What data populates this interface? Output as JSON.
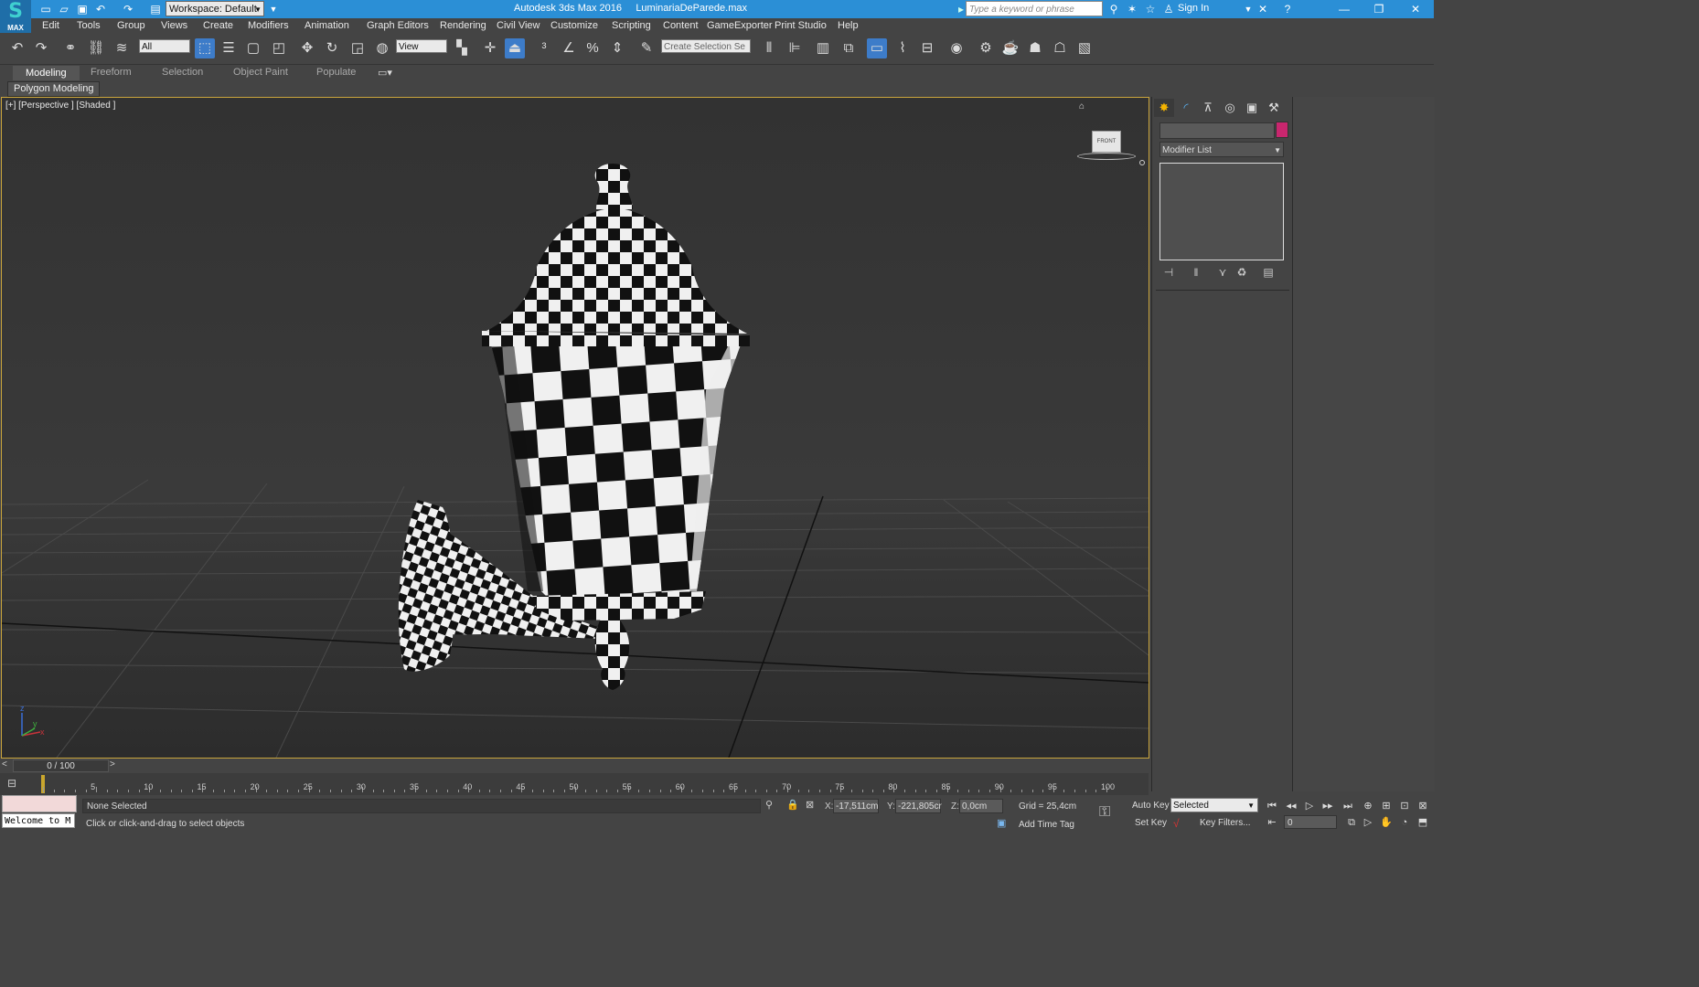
{
  "titlebar": {
    "logo_text": "MAX",
    "workspace": "Workspace: Default",
    "app_title": "Autodesk 3ds Max 2016",
    "file_name": "LuminariaDeParede.max",
    "search_placeholder": "Type a keyword or phrase",
    "sign_in": "Sign In"
  },
  "menu": [
    "Edit",
    "Tools",
    "Group",
    "Views",
    "Create",
    "Modifiers",
    "Animation",
    "Graph Editors",
    "Rendering",
    "Civil View",
    "Customize",
    "Scripting",
    "Content",
    "GameExporter",
    "Print Studio",
    "Help"
  ],
  "toolbar": {
    "selection_filter": "All",
    "ref_coord": "View",
    "named_selection_placeholder": "Create Selection Se"
  },
  "ribbon": {
    "tabs": [
      "Modeling",
      "Freeform",
      "Selection",
      "Object Paint",
      "Populate"
    ],
    "panel": "Polygon Modeling"
  },
  "viewport": {
    "label": "[+] [Perspective ] [Shaded ]",
    "viewcube_face": "FRONT",
    "gizmo_axis_z": "z",
    "gizmo_axis_y": "y",
    "gizmo_axis_x": "x"
  },
  "command_panel": {
    "modifier_list": "Modifier List",
    "object_color": "#c8266e"
  },
  "timeline": {
    "slider": "0 / 100",
    "ticks": [
      "5",
      "10",
      "15",
      "20",
      "25",
      "30",
      "35",
      "40",
      "45",
      "50",
      "55",
      "60",
      "65",
      "70",
      "75",
      "80",
      "85",
      "90",
      "95",
      "100"
    ]
  },
  "status": {
    "welcome": "Welcome to M",
    "selection": "None Selected",
    "prompt": "Click or click-and-drag to select objects",
    "x_label": "X:",
    "x_value": "-17,511cm",
    "y_label": "Y:",
    "y_value": "-221,805cr",
    "z_label": "Z:",
    "z_value": "0,0cm",
    "grid": "Grid = 25,4cm",
    "add_time_tag": "Add Time Tag",
    "auto_key": "Auto Key",
    "set_key": "Set Key",
    "key_mode": "Selected",
    "key_filters": "Key Filters...",
    "frame": "0"
  }
}
